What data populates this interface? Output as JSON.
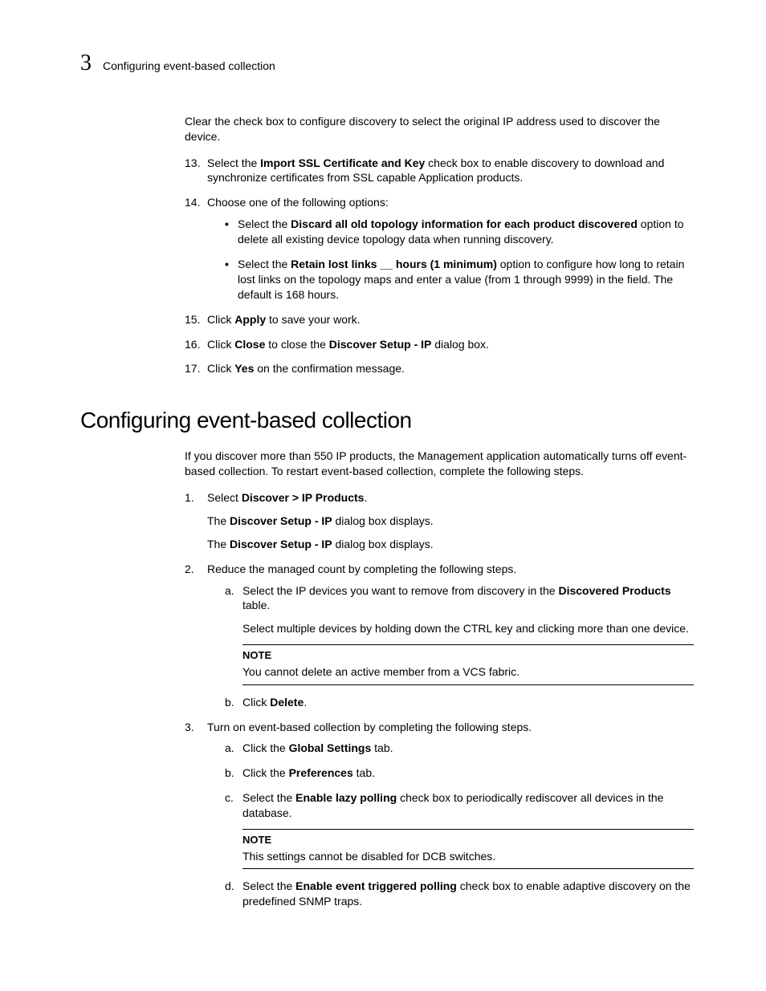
{
  "header": {
    "chapter_number": "3",
    "chapter_title": "Configuring event-based collection"
  },
  "intro_para": "Clear the check box to configure discovery to select the original IP address used to discover the device.",
  "list1": [
    {
      "num": "13.",
      "pre": "Select the ",
      "bold": "Import SSL Certificate and Key",
      "post": " check box to enable discovery to download and synchronize certificates from SSL capable Application products."
    },
    {
      "num": "14.",
      "text": "Choose one of the following options:",
      "bullets": [
        {
          "pre": "Select the ",
          "bold": "Discard all old topology information for each product discovered",
          "post": " option to delete all existing device topology data when running discovery."
        },
        {
          "pre": "Select the ",
          "bold": "Retain lost links __ hours (1 minimum)",
          "post": " option to configure how long to retain lost links on the topology maps and enter a value (from 1 through 9999) in the field. The default is 168 hours."
        }
      ]
    },
    {
      "num": "15.",
      "pre": "Click ",
      "bold": "Apply",
      "post": " to save your work."
    },
    {
      "num": "16.",
      "pre": "Click ",
      "bold1": "Close",
      "mid": " to close the ",
      "bold2": "Discover Setup - IP",
      "post": " dialog box."
    },
    {
      "num": "17.",
      "pre": "Click ",
      "bold": "Yes",
      "post": " on the confirmation message."
    }
  ],
  "section_title": "Configuring event-based collection",
  "section_intro": "If you discover more than 550 IP products, the Management application automatically turns off event-based collection. To restart event-based collection, complete the following steps.",
  "list2": [
    {
      "num": "1.",
      "pre": "Select ",
      "bold": "Discover > IP Products",
      "post": ".",
      "sub": [
        {
          "pre": "The ",
          "bold": "Discover Setup - IP",
          "post": " dialog box displays."
        },
        {
          "pre": "The ",
          "bold": "Discover Setup - IP",
          "post": " dialog box displays."
        }
      ]
    },
    {
      "num": "2.",
      "text": "Reduce the managed count by completing the following steps.",
      "lettered": [
        {
          "let": "a.",
          "pre": "Select the IP devices you want to remove from discovery in the ",
          "bold": "Discovered Products",
          "post": " table.",
          "sub": "Select multiple devices by holding down the CTRL key and clicking more than one device.",
          "note": {
            "label": "NOTE",
            "body": "You cannot delete an active member from a VCS fabric."
          }
        },
        {
          "let": "b.",
          "pre": "Click ",
          "bold": "Delete",
          "post": "."
        }
      ]
    },
    {
      "num": "3.",
      "text": "Turn on event-based collection by completing the following steps.",
      "lettered": [
        {
          "let": "a.",
          "pre": "Click the ",
          "bold": "Global Settings",
          "post": " tab."
        },
        {
          "let": "b.",
          "pre": "Click the ",
          "bold": "Preferences",
          "post": " tab."
        },
        {
          "let": "c.",
          "pre": "Select the ",
          "bold": "Enable lazy polling",
          "post": " check box to periodically rediscover all devices in the database.",
          "note": {
            "label": "NOTE",
            "body": "This settings cannot be disabled for DCB switches."
          }
        },
        {
          "let": "d.",
          "pre": "Select the ",
          "bold": "Enable event triggered polling",
          "post": " check box to enable adaptive discovery on the predefined SNMP traps."
        }
      ]
    }
  ]
}
